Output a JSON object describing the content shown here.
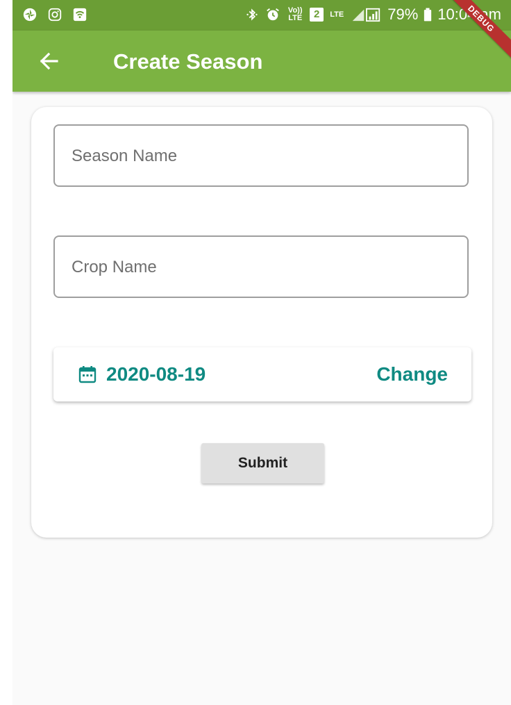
{
  "status_bar": {
    "left_icons": [
      "pinwheel-icon",
      "instagram-icon",
      "wifi-icon"
    ],
    "right_icons": [
      "bluetooth-icon",
      "alarm-icon",
      "volte-icon",
      "sim2-icon",
      "lte-icon",
      "signal-icon",
      "battery-icon"
    ],
    "volte_label": "Vo)) LTE",
    "sim_label": "2",
    "lte_label": "LTE",
    "battery_percent": "79%",
    "time": "10:04 am"
  },
  "app_bar": {
    "title": "Create Season",
    "back_icon": "arrow-left-icon",
    "color": "#7cb342"
  },
  "debug_banner": "DEBUG",
  "form": {
    "season_name": {
      "placeholder": "Season Name",
      "value": ""
    },
    "crop_name": {
      "placeholder": "Crop Name",
      "value": ""
    },
    "date": {
      "icon": "calendar-icon",
      "value": "2020-08-19",
      "change_label": "Change",
      "color": "#0f8a82"
    },
    "submit_label": "Submit"
  }
}
